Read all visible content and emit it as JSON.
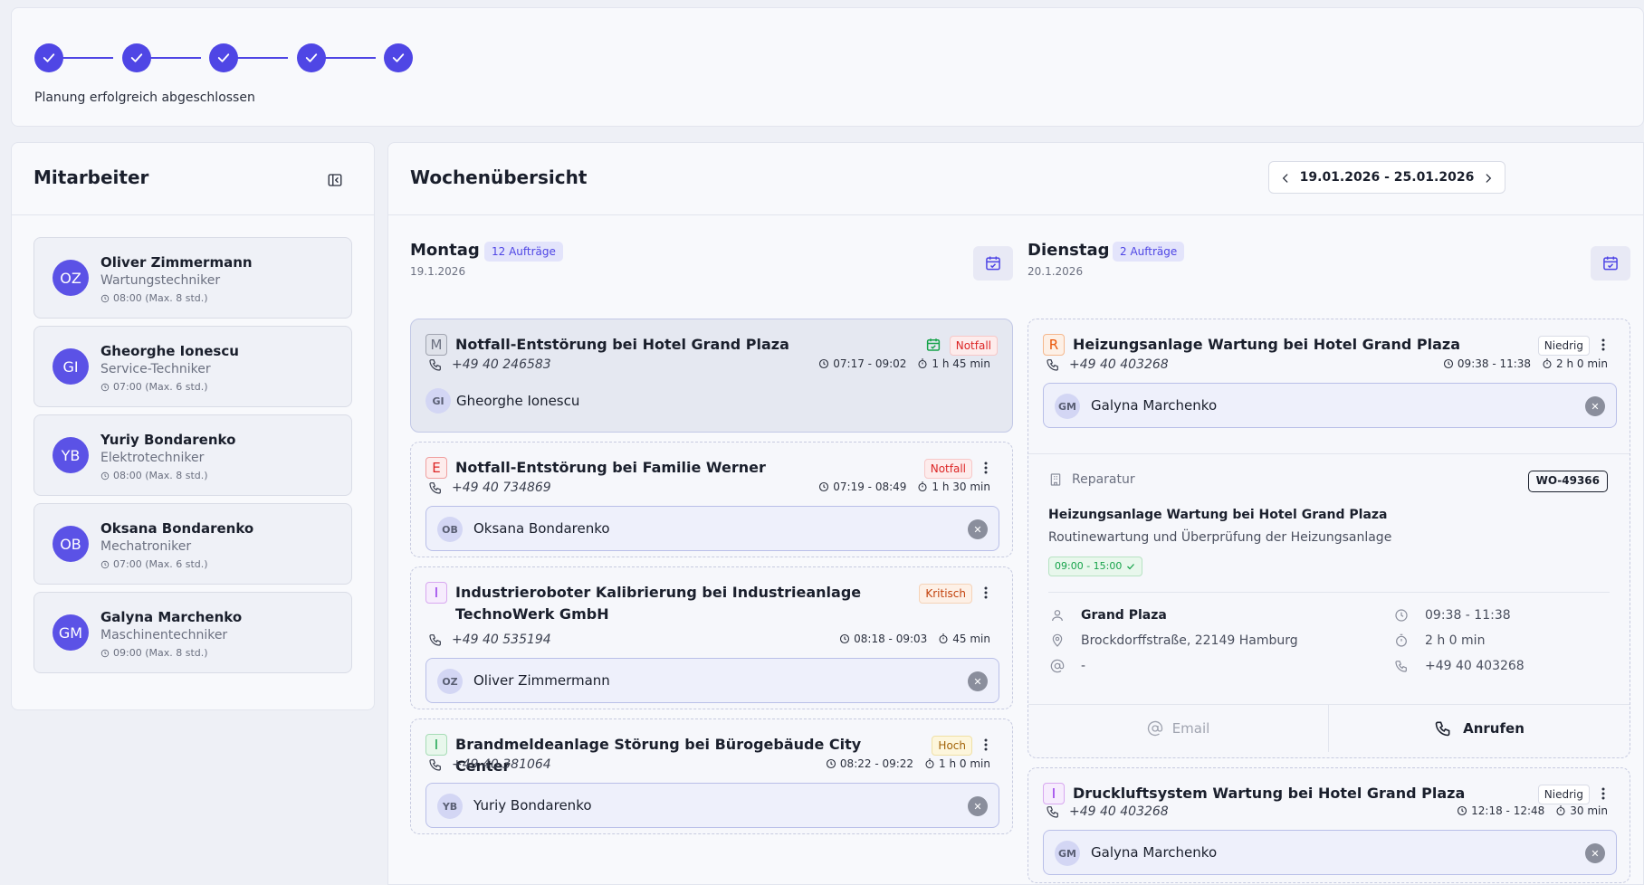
{
  "stepper": {
    "steps": [
      "complete",
      "complete",
      "complete",
      "complete",
      "complete"
    ],
    "label": "Planung erfolgreich abgeschlossen",
    "accent": "#4f46e5"
  },
  "employees_panel": {
    "title": "Mitarbeiter",
    "employees": [
      {
        "initials": "OZ",
        "name": "Oliver Zimmermann",
        "role": "Wartungstechniker",
        "hours": "08:00 (Max. 8 std.)"
      },
      {
        "initials": "GI",
        "name": "Gheorghe Ionescu",
        "role": "Service-Techniker",
        "hours": "07:00 (Max. 6 std.)"
      },
      {
        "initials": "YB",
        "name": "Yuriy Bondarenko",
        "role": "Elektrotechniker",
        "hours": "08:00 (Max. 8 std.)"
      },
      {
        "initials": "OB",
        "name": "Oksana Bondarenko",
        "role": "Mechatroniker",
        "hours": "07:00 (Max. 6 std.)"
      },
      {
        "initials": "GM",
        "name": "Galyna Marchenko",
        "role": "Maschinentechniker",
        "hours": "09:00 (Max. 8 std.)"
      }
    ]
  },
  "overview": {
    "title": "Wochenübersicht",
    "week_range": "19.01.2026 - 25.01.2026"
  },
  "monday": {
    "name": "Montag",
    "count": "12 Aufträge",
    "date": "19.1.2026",
    "jobs": [
      {
        "letter": "M",
        "title": "Notfall-Entstörung bei Hotel Grand Plaza",
        "badge": "Notfall",
        "phone": "+49 40 246583",
        "time": "07:17 - 09:02",
        "duration": "1 h 45 min",
        "assignee_initials": "GI",
        "assignee": "Gheorghe Ionescu"
      },
      {
        "letter": "E",
        "title": "Notfall-Entstörung bei Familie Werner",
        "badge": "Notfall",
        "phone": "+49 40 734869",
        "time": "07:19 - 08:49",
        "duration": "1 h 30 min",
        "assignee_initials": "OB",
        "assignee": "Oksana Bondarenko"
      },
      {
        "letter": "I",
        "title": "Industrieroboter Kalibrierung bei Industrieanlage TechnoWerk GmbH",
        "badge": "Kritisch",
        "phone": "+49 40 535194",
        "time": "08:18 - 09:03",
        "duration": "45 min",
        "assignee_initials": "OZ",
        "assignee": "Oliver Zimmermann"
      },
      {
        "letter": "I",
        "title": "Brandmeldeanlage Störung bei Bürogebäude City Center",
        "badge": "Hoch",
        "phone": "+49 40 381064",
        "time": "08:22 - 09:22",
        "duration": "1 h 0 min",
        "assignee_initials": "YB",
        "assignee": "Yuriy Bondarenko"
      }
    ]
  },
  "tuesday": {
    "name": "Dienstag",
    "count": "2 Aufträge",
    "date": "20.1.2026",
    "jobs": [
      {
        "letter": "R",
        "title": "Heizungsanlage Wartung bei Hotel Grand Plaza",
        "badge": "Niedrig",
        "phone": "+49 40 403268",
        "time": "09:38 - 11:38",
        "duration": "2 h 0 min",
        "assignee_initials": "GM",
        "assignee": "Galyna Marchenko",
        "detail": {
          "type": "Reparatur",
          "wo": "WO-49366",
          "title": "Heizungsanlage Wartung bei Hotel Grand Plaza",
          "description": "Routinewartung und Überprüfung der Heizungsanlage",
          "window": "09:00 - 15:00",
          "customer": "Grand Plaza",
          "address": "Brockdorffstraße, 22149 Hamburg",
          "email": "-",
          "time": "09:38 - 11:38",
          "duration": "2 h 0 min",
          "phone": "+49 40 403268",
          "email_button": "Email",
          "call_button": "Anrufen"
        }
      },
      {
        "letter": "I",
        "title": "Druckluftsystem Wartung bei Hotel Grand Plaza",
        "badge": "Niedrig",
        "phone": "+49 40 403268",
        "time": "12:18 - 12:48",
        "duration": "30 min",
        "assignee_initials": "GM",
        "assignee": "Galyna Marchenko"
      }
    ]
  }
}
